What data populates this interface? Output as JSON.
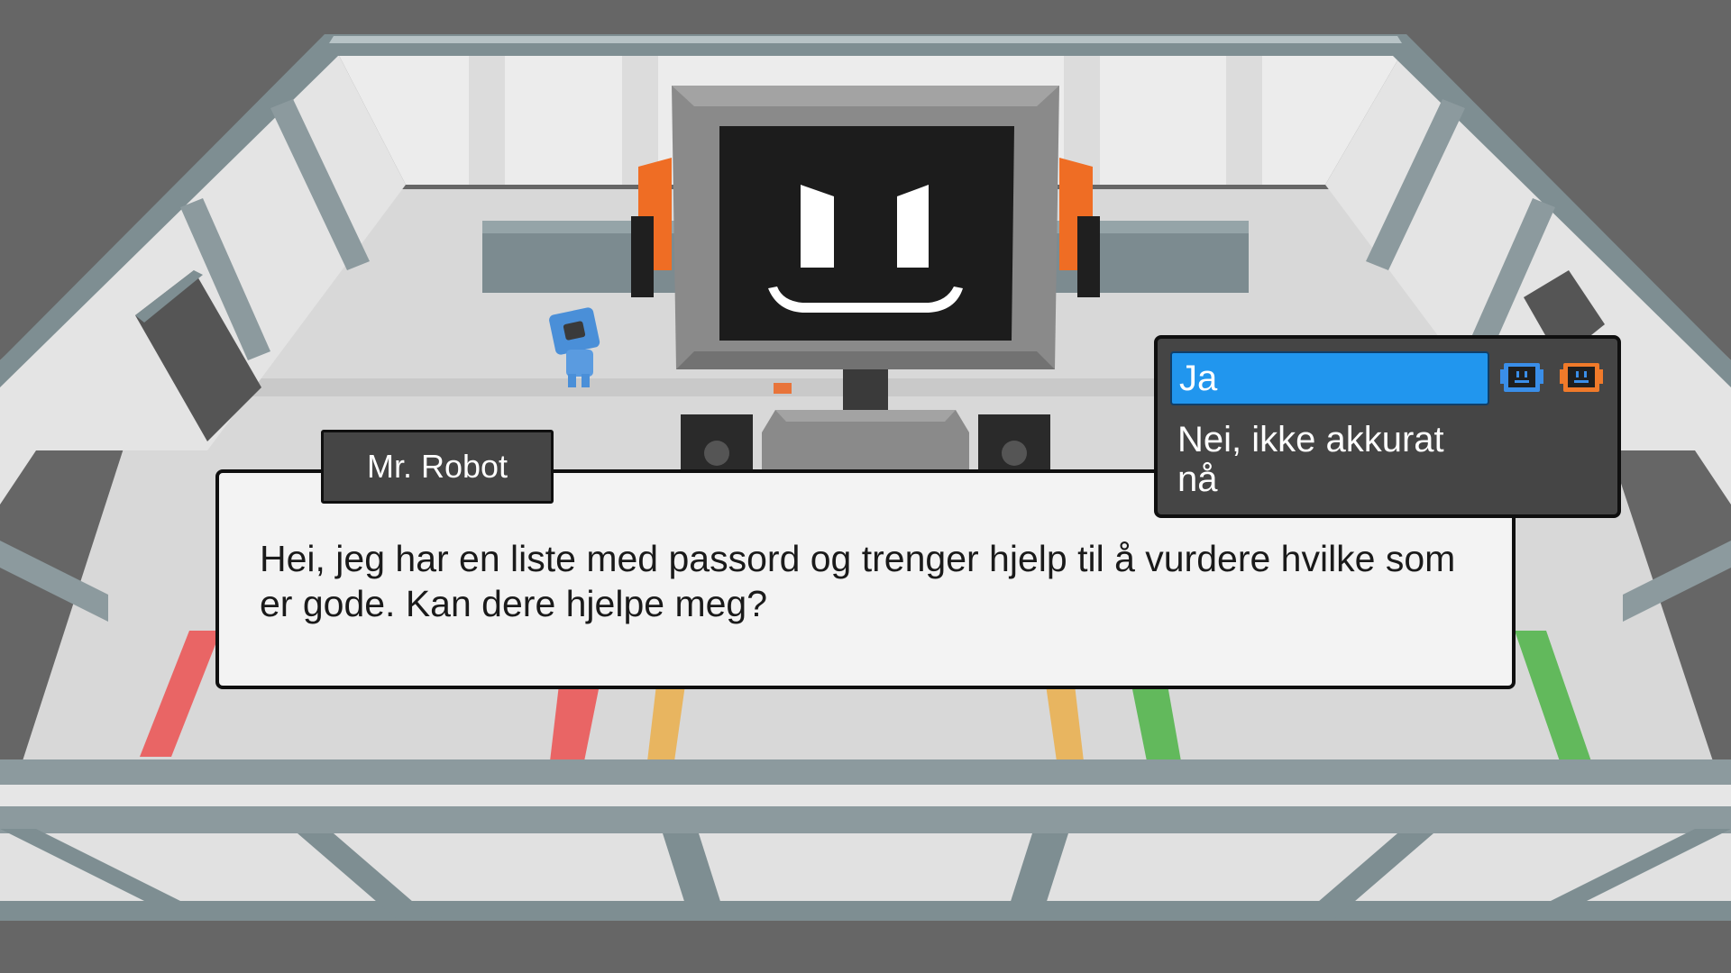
{
  "dialog": {
    "speaker": "Mr. Robot",
    "text": "Hei, jeg har en liste med passord og trenger hjelp til å vurdere hvilke som er gode. Kan dere hjelpe meg?"
  },
  "choices": [
    {
      "label": "Ja",
      "selected": true
    },
    {
      "label": "Nei, ikke akkurat nå",
      "selected": false
    }
  ],
  "players": [
    {
      "icon": "robot-face-icon",
      "color": "#3a8ee8"
    },
    {
      "icon": "robot-face-icon",
      "color": "#f07a2a"
    }
  ],
  "colors": {
    "background": "#666666",
    "floor": "#d6d6d6",
    "wall": "#e8e8e8",
    "wall_frame": "#7e8e92",
    "robot_body": "#8a8a8a",
    "robot_screen": "#1c1c1c",
    "robot_ears": "#ef6d24",
    "stripe_red": "#e96565",
    "stripe_yellow": "#e8b560",
    "stripe_green": "#62b95c",
    "selection": "#2196ee"
  }
}
